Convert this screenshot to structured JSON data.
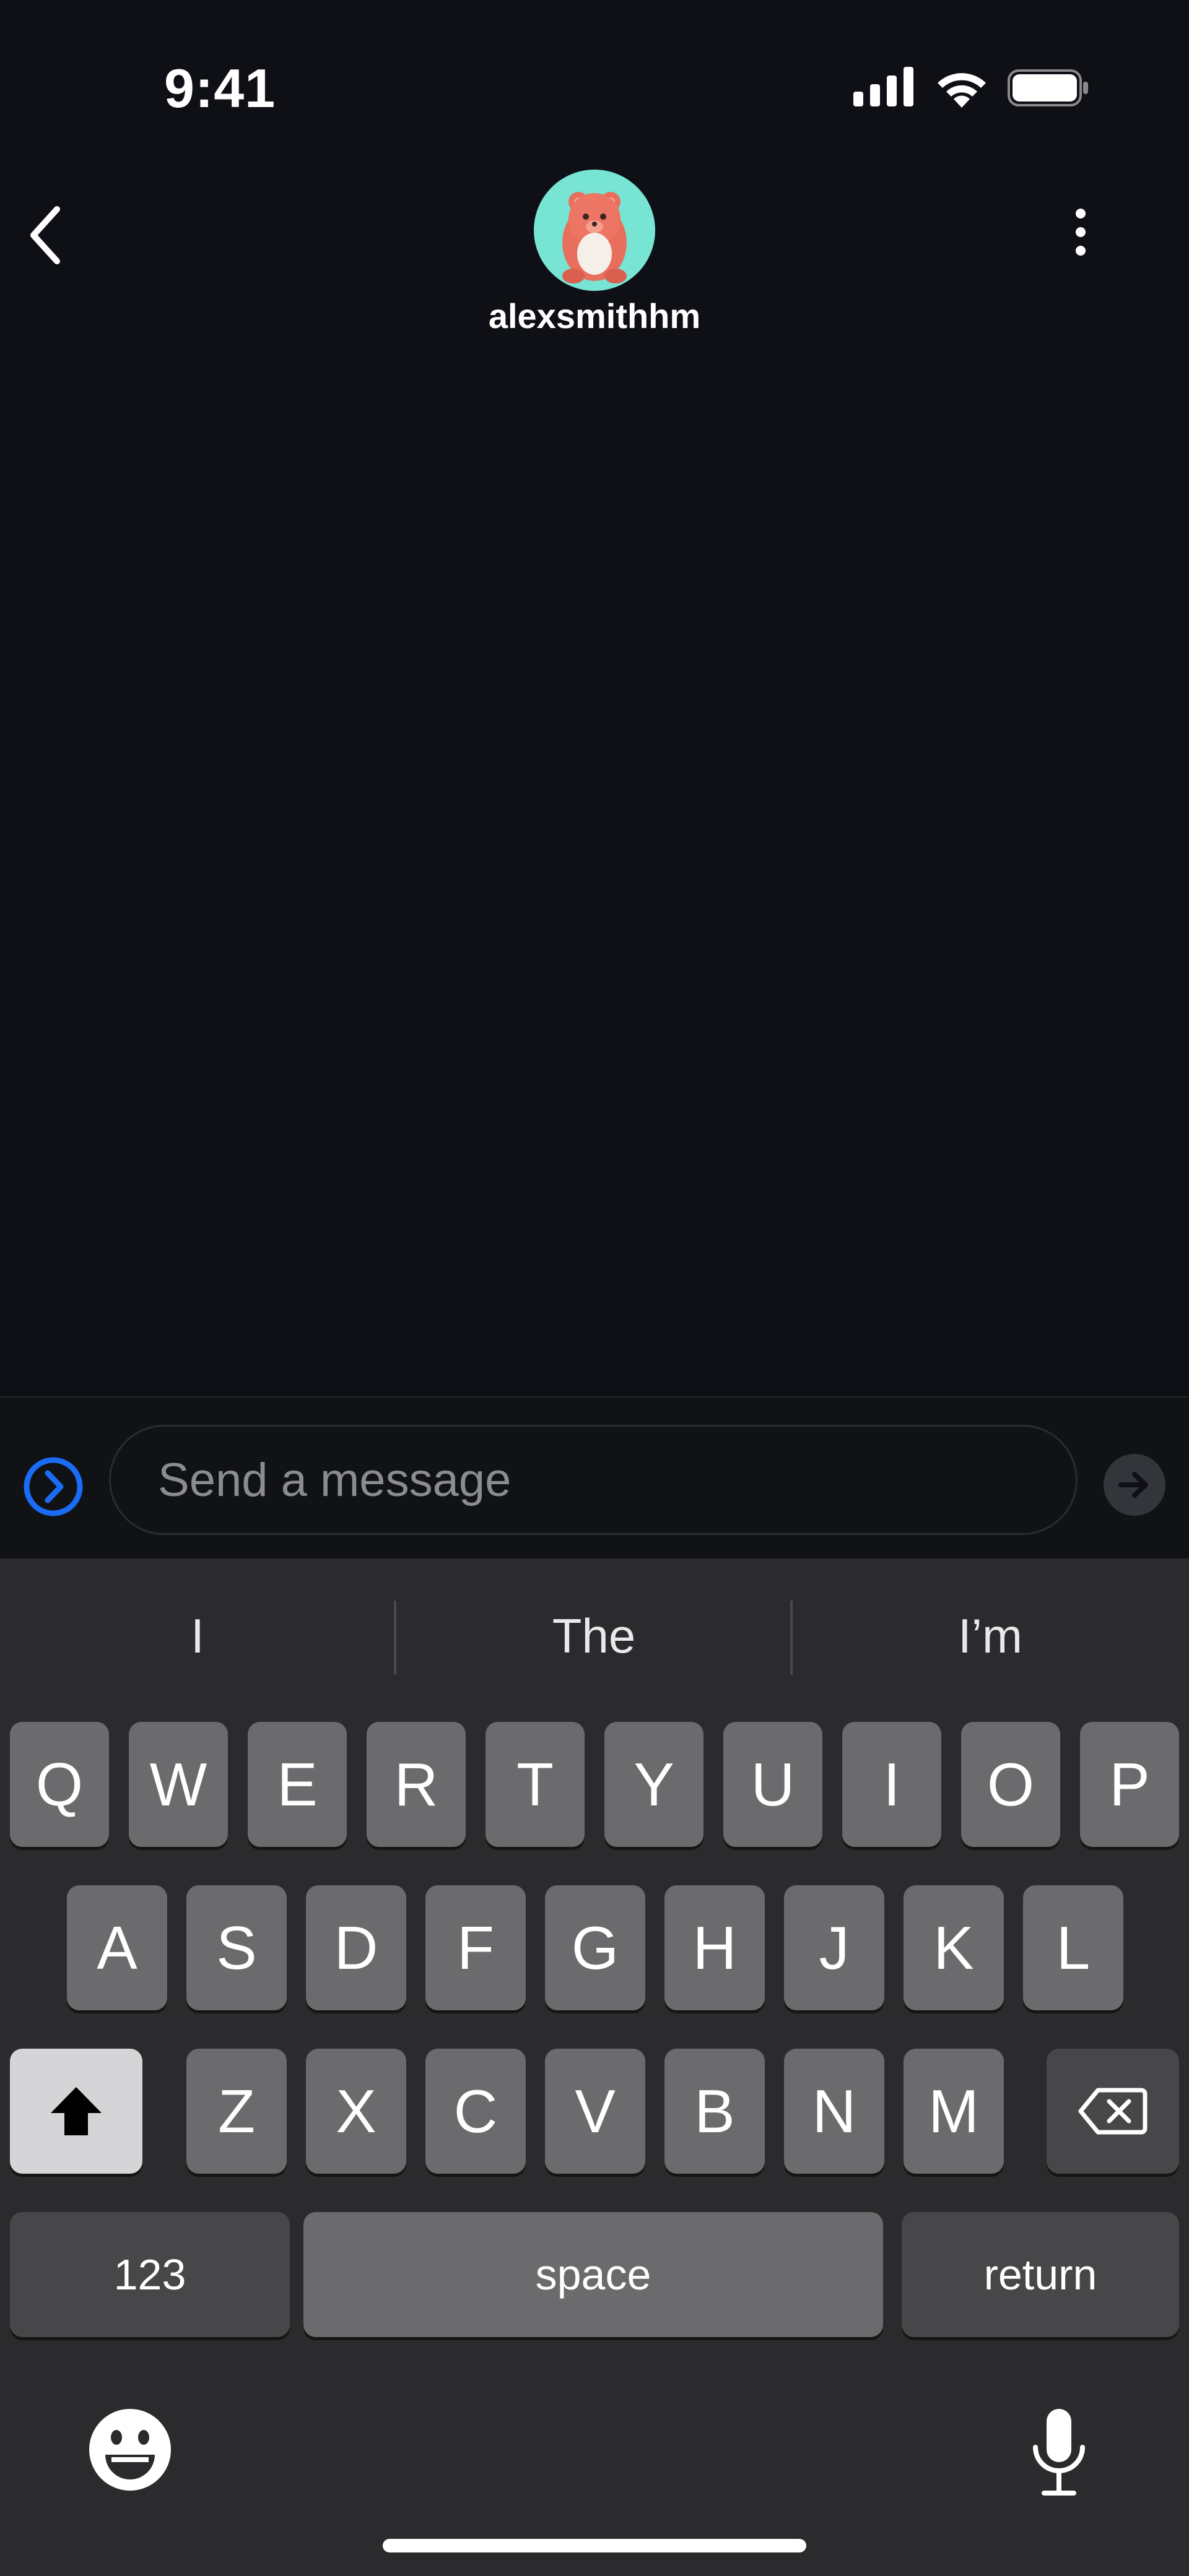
{
  "theme": {
    "background": "#0f1015",
    "accent": "#1a6cf5",
    "avatar_bg": "#77e4d4"
  },
  "status_bar": {
    "time": "9:41",
    "icons": [
      "cellular-signal-icon",
      "wifi-icon",
      "battery-icon"
    ]
  },
  "header": {
    "username": "alexsmithhm",
    "icons": {
      "back": "chevron-left-icon",
      "avatar": "bear-avatar",
      "menu": "more-vertical-icon"
    }
  },
  "composer": {
    "placeholder": "Send a message",
    "value": "",
    "icons": {
      "expand": "chevron-right-circle-icon",
      "send": "arrow-right-icon"
    }
  },
  "keyboard": {
    "suggestions": [
      "I",
      "The",
      "I’m"
    ],
    "rows": [
      [
        "Q",
        "W",
        "E",
        "R",
        "T",
        "Y",
        "U",
        "I",
        "O",
        "P"
      ],
      [
        "A",
        "S",
        "D",
        "F",
        "G",
        "H",
        "J",
        "K",
        "L"
      ],
      [
        "Z",
        "X",
        "C",
        "V",
        "B",
        "N",
        "M"
      ]
    ],
    "numbers_label": "123",
    "space_label": "space",
    "return_label": "return",
    "icons": {
      "shift": "shift-icon",
      "backspace": "backspace-icon",
      "emoji": "emoji-icon",
      "mic": "microphone-icon"
    }
  }
}
